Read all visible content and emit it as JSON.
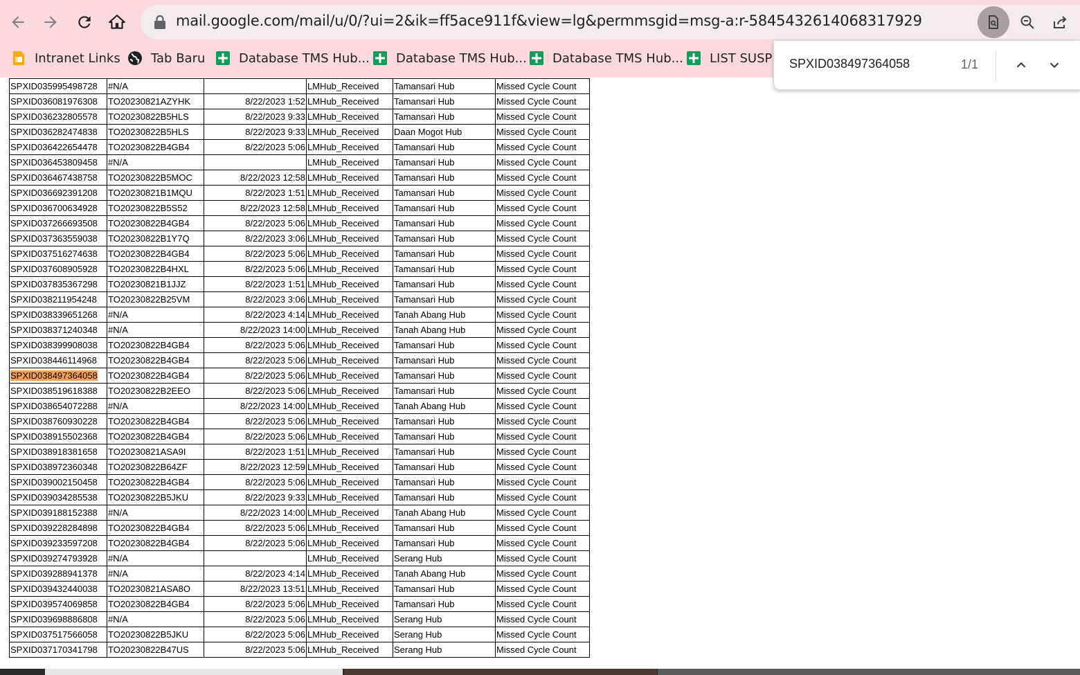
{
  "browser": {
    "url": "mail.google.com/mail/u/0/?ui=2&ik=ff5ace911f&view=lg&permmsgid=msg-a:r-5845432614068317929",
    "colors": {
      "chrome": "#fbd9de",
      "omnibox": "#f3ecee",
      "highlight": "#f6a04d"
    },
    "bookmarks": [
      {
        "label": "Intranet Links",
        "icon": "google-sites-icon"
      },
      {
        "label": "Tab Baru",
        "icon": "globe-icon"
      },
      {
        "label": "Database TMS Hub...",
        "icon": "google-sheets-icon"
      },
      {
        "label": "Database TMS Hub...",
        "icon": "google-sheets-icon"
      },
      {
        "label": "Database TMS Hub...",
        "icon": "google-sheets-icon"
      },
      {
        "label": "LIST SUSPE",
        "icon": "google-sheets-icon"
      }
    ]
  },
  "find": {
    "query": "SPXID038497364058",
    "count": "1/1"
  },
  "sheet": {
    "highlight_row": 19,
    "rows": [
      [
        "SPXID035995498728",
        "#N/A",
        "",
        "LMHub_Received",
        "Tamansari Hub",
        "Missed Cycle Count"
      ],
      [
        "SPXID036081976308",
        "TO20230821AZYHK",
        "8/22/2023 1:52",
        "LMHub_Received",
        "Tamansari Hub",
        "Missed Cycle Count"
      ],
      [
        "SPXID036232805578",
        "TO20230822B5HLS",
        "8/22/2023 9:33",
        "LMHub_Received",
        "Tamansari Hub",
        "Missed Cycle Count"
      ],
      [
        "SPXID036282474838",
        "TO20230822B5HLS",
        "8/22/2023 9:33",
        "LMHub_Received",
        "Daan Mogot Hub",
        "Missed Cycle Count"
      ],
      [
        "SPXID036422654478",
        "TO20230822B4GB4",
        "8/22/2023 5:06",
        "LMHub_Received",
        "Tamansari Hub",
        "Missed Cycle Count"
      ],
      [
        "SPXID036453809458",
        "#N/A",
        "",
        "LMHub_Received",
        "Tamansari Hub",
        "Missed Cycle Count"
      ],
      [
        "SPXID036467438758",
        "TO20230822B5MOC",
        "8/22/2023 12:58",
        "LMHub_Received",
        "Tamansari Hub",
        "Missed Cycle Count"
      ],
      [
        "SPXID036692391208",
        "TO20230821B1MQU",
        "8/22/2023 1:51",
        "LMHub_Received",
        "Tamansari Hub",
        "Missed Cycle Count"
      ],
      [
        "SPXID036700634928",
        "TO20230822B5S52",
        "8/22/2023 12:58",
        "LMHub_Received",
        "Tamansari Hub",
        "Missed Cycle Count"
      ],
      [
        "SPXID037266693508",
        "TO20230822B4GB4",
        "8/22/2023 5:06",
        "LMHub_Received",
        "Tamansari Hub",
        "Missed Cycle Count"
      ],
      [
        "SPXID037363559038",
        "TO20230822B1Y7Q",
        "8/22/2023 3:06",
        "LMHub_Received",
        "Tamansari Hub",
        "Missed Cycle Count"
      ],
      [
        "SPXID037516274638",
        "TO20230822B4GB4",
        "8/22/2023 5:06",
        "LMHub_Received",
        "Tamansari Hub",
        "Missed Cycle Count"
      ],
      [
        "SPXID037608905928",
        "TO20230822B4HXL",
        "8/22/2023 5:06",
        "LMHub_Received",
        "Tamansari Hub",
        "Missed Cycle Count"
      ],
      [
        "SPXID037835367298",
        "TO20230821B1JJZ",
        "8/22/2023 1:51",
        "LMHub_Received",
        "Tamansari Hub",
        "Missed Cycle Count"
      ],
      [
        "SPXID038211954248",
        "TO20230822B25VM",
        "8/22/2023 3:06",
        "LMHub_Received",
        "Tamansari Hub",
        "Missed Cycle Count"
      ],
      [
        "SPXID038339651268",
        "#N/A",
        "8/22/2023 4:14",
        "LMHub_Received",
        "Tanah Abang Hub",
        "Missed Cycle Count"
      ],
      [
        "SPXID038371240348",
        "#N/A",
        "8/22/2023 14:00",
        "LMHub_Received",
        "Tanah Abang Hub",
        "Missed Cycle Count"
      ],
      [
        "SPXID038399908038",
        "TO20230822B4GB4",
        "8/22/2023 5:06",
        "LMHub_Received",
        "Tamansari Hub",
        "Missed Cycle Count"
      ],
      [
        "SPXID038446114968",
        "TO20230822B4GB4",
        "8/22/2023 5:06",
        "LMHub_Received",
        "Tamansari Hub",
        "Missed Cycle Count"
      ],
      [
        "SPXID038497364058",
        "TO20230822B4GB4",
        "8/22/2023 5:06",
        "LMHub_Received",
        "Tamansari Hub",
        "Missed Cycle Count"
      ],
      [
        "SPXID038519618388",
        "TO20230822B2EEO",
        "8/22/2023 5:06",
        "LMHub_Received",
        "Tamansari Hub",
        "Missed Cycle Count"
      ],
      [
        "SPXID038654072288",
        "#N/A",
        "8/22/2023 14:00",
        "LMHub_Received",
        "Tanah Abang Hub",
        "Missed Cycle Count"
      ],
      [
        "SPXID038760930228",
        "TO20230822B4GB4",
        "8/22/2023 5:06",
        "LMHub_Received",
        "Tamansari Hub",
        "Missed Cycle Count"
      ],
      [
        "SPXID038915502368",
        "TO20230822B4GB4",
        "8/22/2023 5:06",
        "LMHub_Received",
        "Tamansari Hub",
        "Missed Cycle Count"
      ],
      [
        "SPXID038918381658",
        "TO20230821ASA9I",
        "8/22/2023 1:51",
        "LMHub_Received",
        "Tamansari Hub",
        "Missed Cycle Count"
      ],
      [
        "SPXID038972360348",
        "TO20230822B64ZF",
        "8/22/2023 12:59",
        "LMHub_Received",
        "Tamansari Hub",
        "Missed Cycle Count"
      ],
      [
        "SPXID039002150458",
        "TO20230822B4GB4",
        "8/22/2023 5:06",
        "LMHub_Received",
        "Tamansari Hub",
        "Missed Cycle Count"
      ],
      [
        "SPXID039034285538",
        "TO20230822B5JKU",
        "8/22/2023 9:33",
        "LMHub_Received",
        "Tamansari Hub",
        "Missed Cycle Count"
      ],
      [
        "SPXID039188152388",
        "#N/A",
        "8/22/2023 14:00",
        "LMHub_Received",
        "Tanah Abang Hub",
        "Missed Cycle Count"
      ],
      [
        "SPXID039228284898",
        "TO20230822B4GB4",
        "8/22/2023 5:06",
        "LMHub_Received",
        "Tamansari Hub",
        "Missed Cycle Count"
      ],
      [
        "SPXID039233597208",
        "TO20230822B4GB4",
        "8/22/2023 5:06",
        "LMHub_Received",
        "Tamansari Hub",
        "Missed Cycle Count"
      ],
      [
        "SPXID039274793928",
        "#N/A",
        "",
        "LMHub_Received",
        "Serang Hub",
        "Missed Cycle Count"
      ],
      [
        "SPXID039288941378",
        "#N/A",
        "8/22/2023 4:14",
        "LMHub_Received",
        "Tanah Abang Hub",
        "Missed Cycle Count"
      ],
      [
        "SPXID039432440038",
        "TO20230821ASA8O",
        "8/22/2023 13:51",
        "LMHub_Received",
        "Tamansari Hub",
        "Missed Cycle Count"
      ],
      [
        "SPXID039574069858",
        "TO20230822B4GB4",
        "8/22/2023 5:06",
        "LMHub_Received",
        "Tamansari Hub",
        "Missed Cycle Count"
      ],
      [
        "SPXID039698886808",
        "#N/A",
        "8/22/2023 5:06",
        "LMHub_Received",
        "Serang Hub",
        "Missed Cycle Count"
      ],
      [
        "SPXID037517566058",
        "TO20230822B5JKU",
        "8/22/2023 5:06",
        "LMHub_Received",
        "Serang Hub",
        "Missed Cycle Count"
      ],
      [
        "SPXID037170341798",
        "TO20230822B47US",
        "8/22/2023 5:06",
        "LMHub_Received",
        "Serang Hub",
        "Missed Cycle Count"
      ]
    ]
  }
}
